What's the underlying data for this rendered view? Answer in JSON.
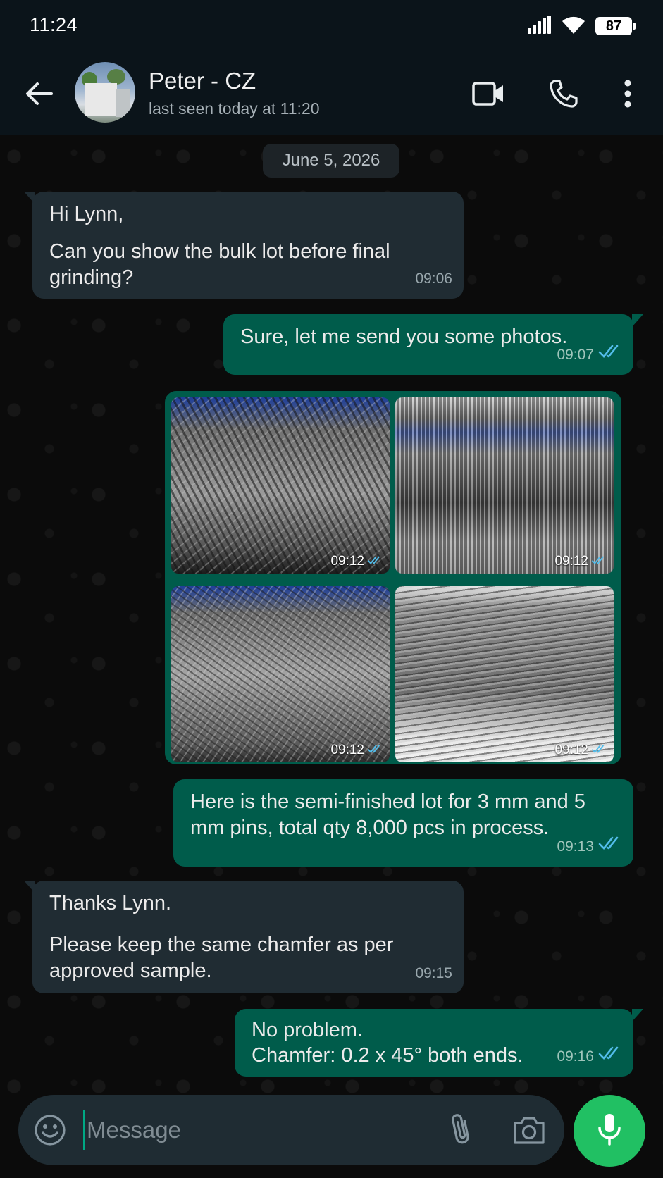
{
  "status_bar": {
    "time": "11:24",
    "battery": "87",
    "icons": [
      "signal-icon",
      "wifi-icon",
      "battery-icon"
    ]
  },
  "header": {
    "contact_name": "Peter - CZ",
    "last_seen": "last seen today at 11:20",
    "icons": [
      "back-arrow-icon",
      "video-call-icon",
      "phone-icon",
      "more-options-icon"
    ]
  },
  "chat": {
    "date_label": "June 5, 2026",
    "messages": [
      {
        "direction": "in",
        "lines": [
          "Hi Lynn,",
          "Can you show the bulk lot before final grinding?"
        ],
        "time": "09:06"
      },
      {
        "direction": "out",
        "lines": [
          "Sure, let me send you some photos."
        ],
        "time": "09:07",
        "read": true
      },
      {
        "direction": "out",
        "type": "photos",
        "photos": [
          {
            "time": "09:12",
            "read": true
          },
          {
            "time": "09:12",
            "read": true
          },
          {
            "time": "09:12",
            "read": true
          },
          {
            "time": "09:12",
            "read": true
          }
        ]
      },
      {
        "direction": "out",
        "lines": [
          "Here is the semi-finished lot for 3 mm and 5 mm pins, total qty 8,000 pcs in process."
        ],
        "time": "09:13",
        "read": true
      },
      {
        "direction": "in",
        "lines": [
          "Thanks Lynn.",
          "Please keep the same chamfer as per approved sample."
        ],
        "time": "09:15"
      },
      {
        "direction": "out",
        "lines": [
          "No problem.",
          "Chamfer: 0.2 x 45° both ends."
        ],
        "time": "09:16",
        "read": true
      }
    ]
  },
  "input_bar": {
    "placeholder": "Message",
    "value": "",
    "icons": [
      "emoji-icon",
      "attach-icon",
      "camera-icon",
      "mic-icon"
    ]
  },
  "colors": {
    "header_bg": "#0b141a",
    "incoming_bubble": "#202c33",
    "outgoing_bubble": "#005c4b",
    "read_tick": "#53bdeb",
    "mic_button": "#21c063"
  }
}
